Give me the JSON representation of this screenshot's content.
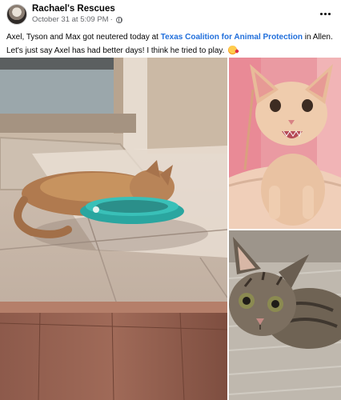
{
  "post": {
    "page_name": "Rachael's Rescues",
    "timestamp": "October 31 at 5:09 PM",
    "separator": "·",
    "caption": {
      "line1_prefix": "Axel, Tyson and Max got neutered today at ",
      "line1_link": "Texas Coalition for Animal Protection",
      "line1_suffix": " in Allen.",
      "line2": "Let's just say Axel has had better days! I think he tried to play. "
    }
  },
  "icons": {
    "privacy": "globe-icon",
    "more": "more-horizontal-icon",
    "emoji": "smiling-face-with-hearts-emoji"
  },
  "colors": {
    "link": "#216fdb",
    "secondary_text": "#65676b",
    "primary_text": "#050505"
  }
}
